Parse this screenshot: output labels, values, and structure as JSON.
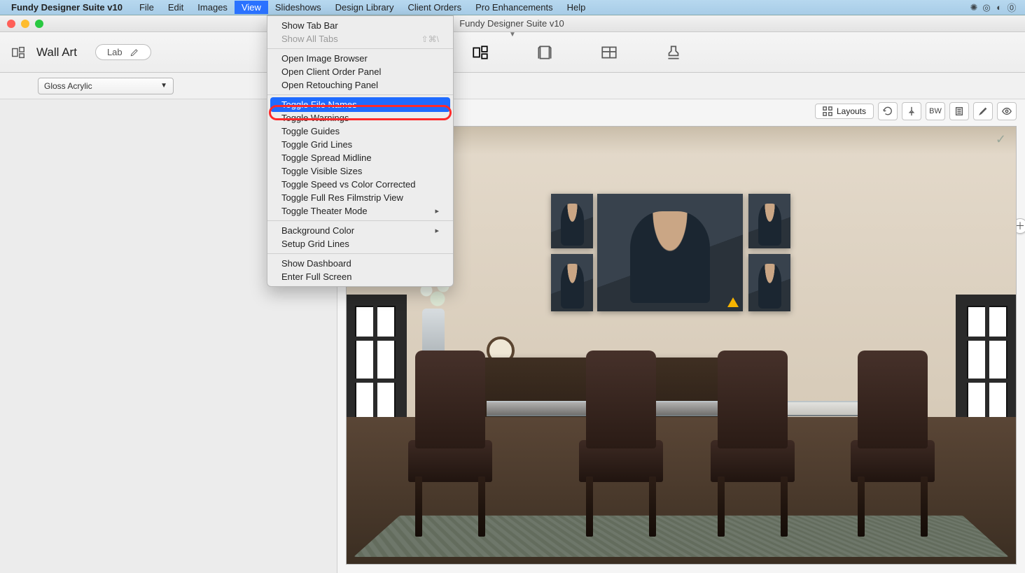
{
  "menubar": {
    "app_name": "Fundy Designer Suite v10",
    "items": [
      "File",
      "Edit",
      "Images",
      "View",
      "Slideshows",
      "Design Library",
      "Client Orders",
      "Pro Enhancements",
      "Help"
    ],
    "active_index": 3
  },
  "window": {
    "title": "Fundy Designer Suite v10"
  },
  "toolbar": {
    "mode_title": "Wall Art",
    "lab_label": "Lab"
  },
  "options": {
    "product_select": "Gloss Acrylic"
  },
  "canvasbar": {
    "layouts_label": "Layouts",
    "bw_label": "BW"
  },
  "view_menu": {
    "groups": [
      [
        {
          "label": "Show Tab Bar",
          "enabled": true
        },
        {
          "label": "Show All Tabs",
          "enabled": false,
          "shortcut": "⇧⌘\\"
        }
      ],
      [
        {
          "label": "Open Image Browser",
          "enabled": true
        },
        {
          "label": "Open Client Order Panel",
          "enabled": true
        },
        {
          "label": "Open Retouching Panel",
          "enabled": true
        }
      ],
      [
        {
          "label": "Toggle File Names",
          "enabled": true,
          "highlight": true
        },
        {
          "label": "Toggle Warnings",
          "enabled": true
        },
        {
          "label": "Toggle Guides",
          "enabled": true
        },
        {
          "label": "Toggle Grid Lines",
          "enabled": true
        },
        {
          "label": "Toggle Spread Midline",
          "enabled": true
        },
        {
          "label": "Toggle Visible Sizes",
          "enabled": true
        },
        {
          "label": "Toggle Speed vs Color Corrected",
          "enabled": true
        },
        {
          "label": "Toggle Full Res Filmstrip View",
          "enabled": true
        },
        {
          "label": "Toggle Theater Mode",
          "enabled": true,
          "submenu": true
        }
      ],
      [
        {
          "label": "Background Color",
          "enabled": true,
          "submenu": true
        },
        {
          "label": "Setup Grid Lines",
          "enabled": true
        }
      ],
      [
        {
          "label": "Show Dashboard",
          "enabled": true
        },
        {
          "label": "Enter Full Screen",
          "enabled": true
        }
      ]
    ]
  }
}
